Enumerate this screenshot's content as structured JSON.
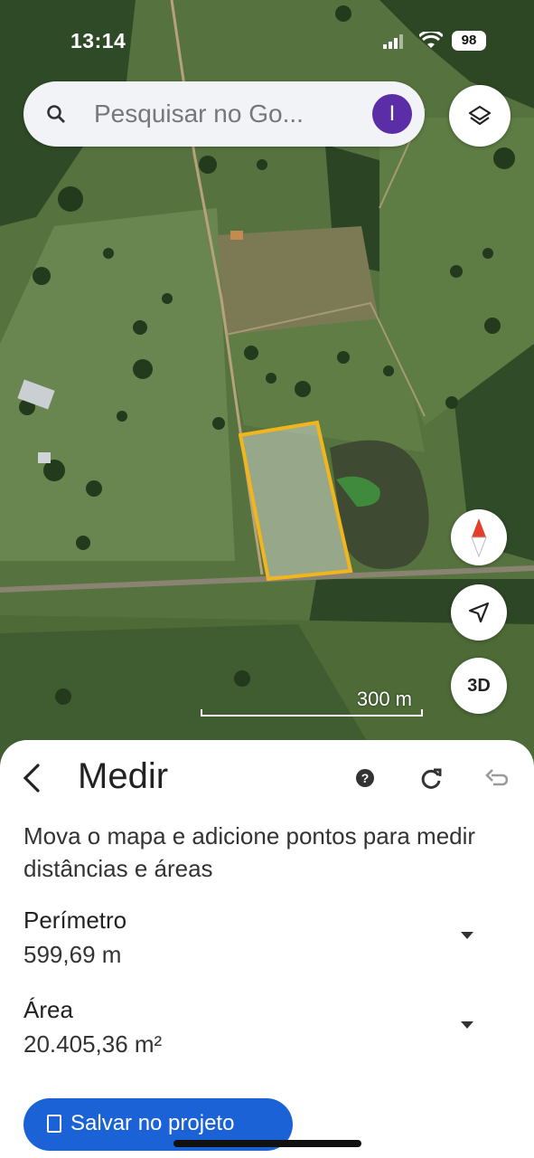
{
  "status_bar": {
    "time": "13:14",
    "battery": "98"
  },
  "search": {
    "placeholder": "Pesquisar no Go...",
    "avatar_initial": "I"
  },
  "map": {
    "scale_label": "300 m",
    "btn_3d_label": "3D",
    "measure_outline_color": "#f2b51c"
  },
  "measure_panel": {
    "title": "Medir",
    "instructions": "Mova o mapa e adicione pontos para medir distâncias e áreas",
    "perimeter_label": "Perímetro",
    "perimeter_value": "599,69 m",
    "area_label": "Área",
    "area_value": "20.405,36 m²",
    "save_button_label": "Salvar no projeto"
  },
  "colors": {
    "accent": "#1a62d6",
    "avatar": "#5b2ea8",
    "compass_red": "#e0402c"
  }
}
